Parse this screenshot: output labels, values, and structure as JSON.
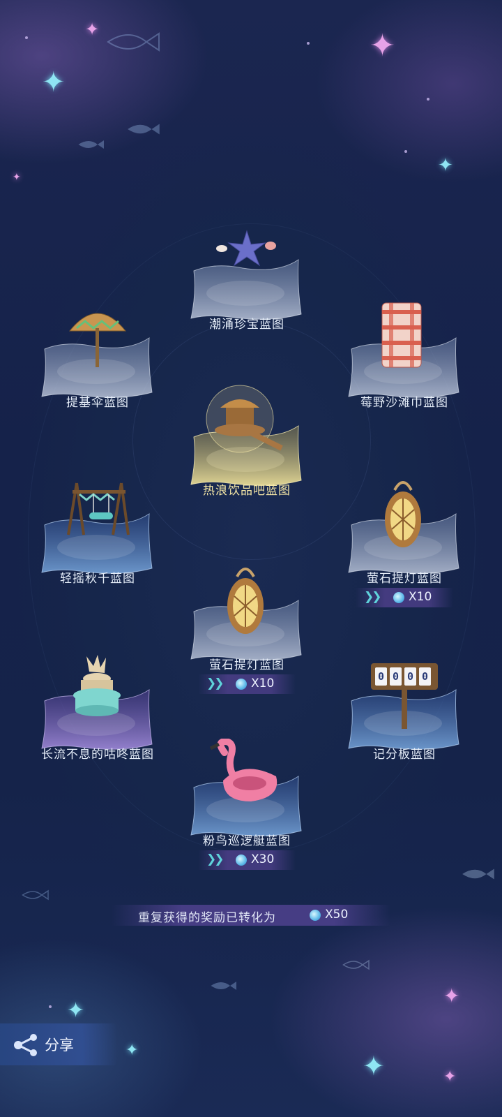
{
  "rewards": [
    {
      "name": "潮涌珍宝蓝图",
      "icon": "starfish-shells-icon",
      "highlight": false
    },
    {
      "name": "提基伞蓝图",
      "icon": "tiki-umbrella-icon",
      "highlight": false
    },
    {
      "name": "莓野沙滩巾蓝图",
      "icon": "beach-towel-icon",
      "highlight": false
    },
    {
      "name": "热浪饮品吧蓝图",
      "icon": "drink-bar-globe-icon",
      "highlight": true
    },
    {
      "name": "轻摇秋千蓝图",
      "icon": "swing-icon",
      "highlight": false
    },
    {
      "name": "萤石提灯蓝图",
      "icon": "lantern-icon",
      "highlight": false,
      "duplicate_qty": "X10"
    },
    {
      "name": "萤石提灯蓝图",
      "icon": "lantern-icon",
      "highlight": false,
      "duplicate_qty": "X10"
    },
    {
      "name": "长流不息的咕咚蓝图",
      "icon": "fountain-icon",
      "highlight": false
    },
    {
      "name": "记分板蓝图",
      "icon": "scoreboard-icon",
      "highlight": false,
      "scoreboard_digits": "0000"
    },
    {
      "name": "粉鸟巡逻艇蓝图",
      "icon": "flamingo-float-icon",
      "highlight": false,
      "duplicate_qty": "X30"
    }
  ],
  "summary": {
    "text": "重复获得的奖励已转化为",
    "qty": "X50",
    "currency_icon": "crystal-gem-icon"
  },
  "share": {
    "label": "分享",
    "icon": "share-icon"
  },
  "colors": {
    "background": "#16244b",
    "badge": "#463c82",
    "chevron": "#5fd3db",
    "gold_label": "#f5e7a6",
    "label": "#e6eef9"
  }
}
